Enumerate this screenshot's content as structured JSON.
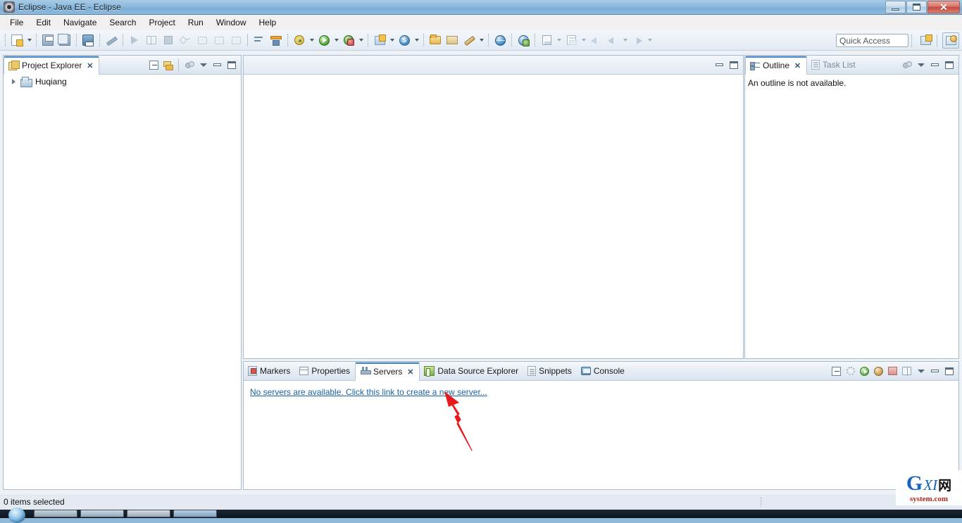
{
  "window": {
    "title": "Eclipse - Java EE - Eclipse",
    "app_icon": "eclipse-icon",
    "controls": {
      "minimize": "–",
      "maximize": "❐",
      "close": "✕"
    }
  },
  "menubar": {
    "items": [
      {
        "label": "File",
        "name": "menu-file"
      },
      {
        "label": "Edit",
        "name": "menu-edit"
      },
      {
        "label": "Navigate",
        "name": "menu-navigate"
      },
      {
        "label": "Search",
        "name": "menu-search"
      },
      {
        "label": "Project",
        "name": "menu-project"
      },
      {
        "label": "Run",
        "name": "menu-run"
      },
      {
        "label": "Window",
        "name": "menu-window"
      },
      {
        "label": "Help",
        "name": "menu-help"
      }
    ]
  },
  "toolbar": {
    "quick_access_placeholder": "Quick Access",
    "buttons": [
      {
        "name": "new-wizard-button",
        "icon": "new-file-icon"
      },
      {
        "name": "save-button",
        "icon": "save-icon"
      },
      {
        "name": "save-all-button",
        "icon": "save-all-icon"
      },
      {
        "name": "print-button",
        "icon": "print-icon"
      },
      {
        "name": "toggle-mark-occurrences-button",
        "icon": "pen-slash-icon"
      },
      {
        "name": "run-last-tool-button",
        "icon": "run-arrow-icon"
      },
      {
        "name": "toggle-breakpoint-button",
        "icon": "columns-icon"
      },
      {
        "name": "terminate-button",
        "icon": "stop-square-icon"
      },
      {
        "name": "step-into-button",
        "icon": "step-into-icon"
      },
      {
        "name": "step-over-button",
        "icon": "step-over-icon"
      },
      {
        "name": "step-return-button",
        "icon": "step-return-icon"
      },
      {
        "name": "resume-button",
        "icon": "resume-icon"
      },
      {
        "name": "new-java-ee-artifact-button",
        "icon": "flow-icon"
      },
      {
        "name": "deploy-button",
        "icon": "deploy-icon"
      },
      {
        "name": "debug-button",
        "icon": "debug-bug-icon"
      },
      {
        "name": "run-button",
        "icon": "run-green-icon"
      },
      {
        "name": "run-as-server-button",
        "icon": "globe-run-icon"
      },
      {
        "name": "new-package-button",
        "icon": "new-package-icon"
      },
      {
        "name": "new-class-button",
        "icon": "new-class-icon"
      },
      {
        "name": "open-type-button",
        "icon": "open-folder-icon"
      },
      {
        "name": "open-resource-button",
        "icon": "folder-icon"
      },
      {
        "name": "external-tools-button",
        "icon": "wrench-icon"
      },
      {
        "name": "open-web-browser-button",
        "icon": "globe-icon"
      },
      {
        "name": "open-web-service-button",
        "icon": "globe-service-icon"
      },
      {
        "name": "new-table-button",
        "icon": "table-icon"
      },
      {
        "name": "new-sql-file-button",
        "icon": "sql-table-icon"
      },
      {
        "name": "back-to-button",
        "icon": "back-row-icon"
      },
      {
        "name": "previous-annotation-button",
        "icon": "arrow-left-icon"
      },
      {
        "name": "next-annotation-button",
        "icon": "arrow-right-icon"
      }
    ],
    "perspective_new": "open-perspective-button",
    "perspective_java_ee": "perspective-java-ee-button"
  },
  "project_explorer": {
    "tab_label": "Project Explorer",
    "tab_close": "✕",
    "tab_icon": "project-explorer-icon",
    "toolbar": [
      {
        "name": "collapse-all-button",
        "icon": "collapse-all-icon"
      },
      {
        "name": "link-with-editor-button",
        "icon": "link-editor-icon"
      },
      {
        "name": "focus-on-active-task-button",
        "icon": "focus-task-icon"
      },
      {
        "name": "view-menu-button",
        "icon": "chevron-down-icon"
      },
      {
        "name": "minimize-button",
        "icon": "minimize-icon"
      },
      {
        "name": "maximize-button",
        "icon": "maximize-icon"
      }
    ],
    "tree": [
      {
        "label": "Huqiang",
        "icon": "project-node-icon",
        "expanded": false
      }
    ]
  },
  "outline": {
    "tabs": [
      {
        "label": "Outline",
        "active": true,
        "icon": "outline-icon",
        "close": "✕"
      },
      {
        "label": "Task List",
        "active": false,
        "icon": "task-list-icon"
      }
    ],
    "toolbar": [
      {
        "name": "focus-on-active-task-button",
        "icon": "focus-task-icon"
      },
      {
        "name": "view-menu-button",
        "icon": "chevron-down-icon"
      },
      {
        "name": "minimize-button",
        "icon": "minimize-icon"
      },
      {
        "name": "maximize-button",
        "icon": "maximize-icon"
      }
    ],
    "message": "An outline is not available."
  },
  "editor_area": {
    "toolbar": [
      {
        "name": "minimize-button",
        "icon": "minimize-icon"
      },
      {
        "name": "maximize-button",
        "icon": "maximize-icon"
      }
    ]
  },
  "bottom_panel": {
    "tabs": [
      {
        "label": "Markers",
        "icon": "markers-icon",
        "active": false,
        "name": "tab-markers"
      },
      {
        "label": "Properties",
        "icon": "properties-icon",
        "active": false,
        "name": "tab-properties"
      },
      {
        "label": "Servers",
        "icon": "servers-icon",
        "active": true,
        "close": "✕",
        "name": "tab-servers"
      },
      {
        "label": "Data Source Explorer",
        "icon": "data-source-explorer-icon",
        "active": false,
        "name": "tab-data-source-explorer"
      },
      {
        "label": "Snippets",
        "icon": "snippets-icon",
        "active": false,
        "name": "tab-snippets"
      },
      {
        "label": "Console",
        "icon": "console-icon",
        "active": false,
        "name": "tab-console"
      }
    ],
    "toolbar": [
      {
        "name": "collapse-all-button",
        "icon": "collapse-all-icon"
      },
      {
        "name": "debug-server-button",
        "icon": "debug-icon"
      },
      {
        "name": "start-server-button",
        "icon": "play-icon"
      },
      {
        "name": "profile-server-button",
        "icon": "profile-icon"
      },
      {
        "name": "publish-button",
        "icon": "publish-icon"
      },
      {
        "name": "configure-button",
        "icon": "configure-icon"
      },
      {
        "name": "view-menu-button",
        "icon": "chevron-down-icon"
      },
      {
        "name": "minimize-button",
        "icon": "minimize-icon"
      },
      {
        "name": "maximize-button",
        "icon": "maximize-icon"
      }
    ],
    "servers_message": "No servers are available. Click this link to create a new server..."
  },
  "statusbar": {
    "text": "0 items selected"
  },
  "annotation": {
    "arrow_color": "#e8191c",
    "name": "red-pointer-arrow"
  },
  "watermark": {
    "g": "G",
    "xi": "XI",
    "cn": "网",
    "sub": "system.com",
    "accent": "#1565c0"
  },
  "colors": {
    "titlebar": "#8db9dc",
    "toolbar_bg": "#eaf0f7",
    "view_border": "#a8bcce",
    "link": "#1762a8",
    "active_tab_accent": "#4a89c8",
    "status_bg": "#e4e9f2"
  }
}
